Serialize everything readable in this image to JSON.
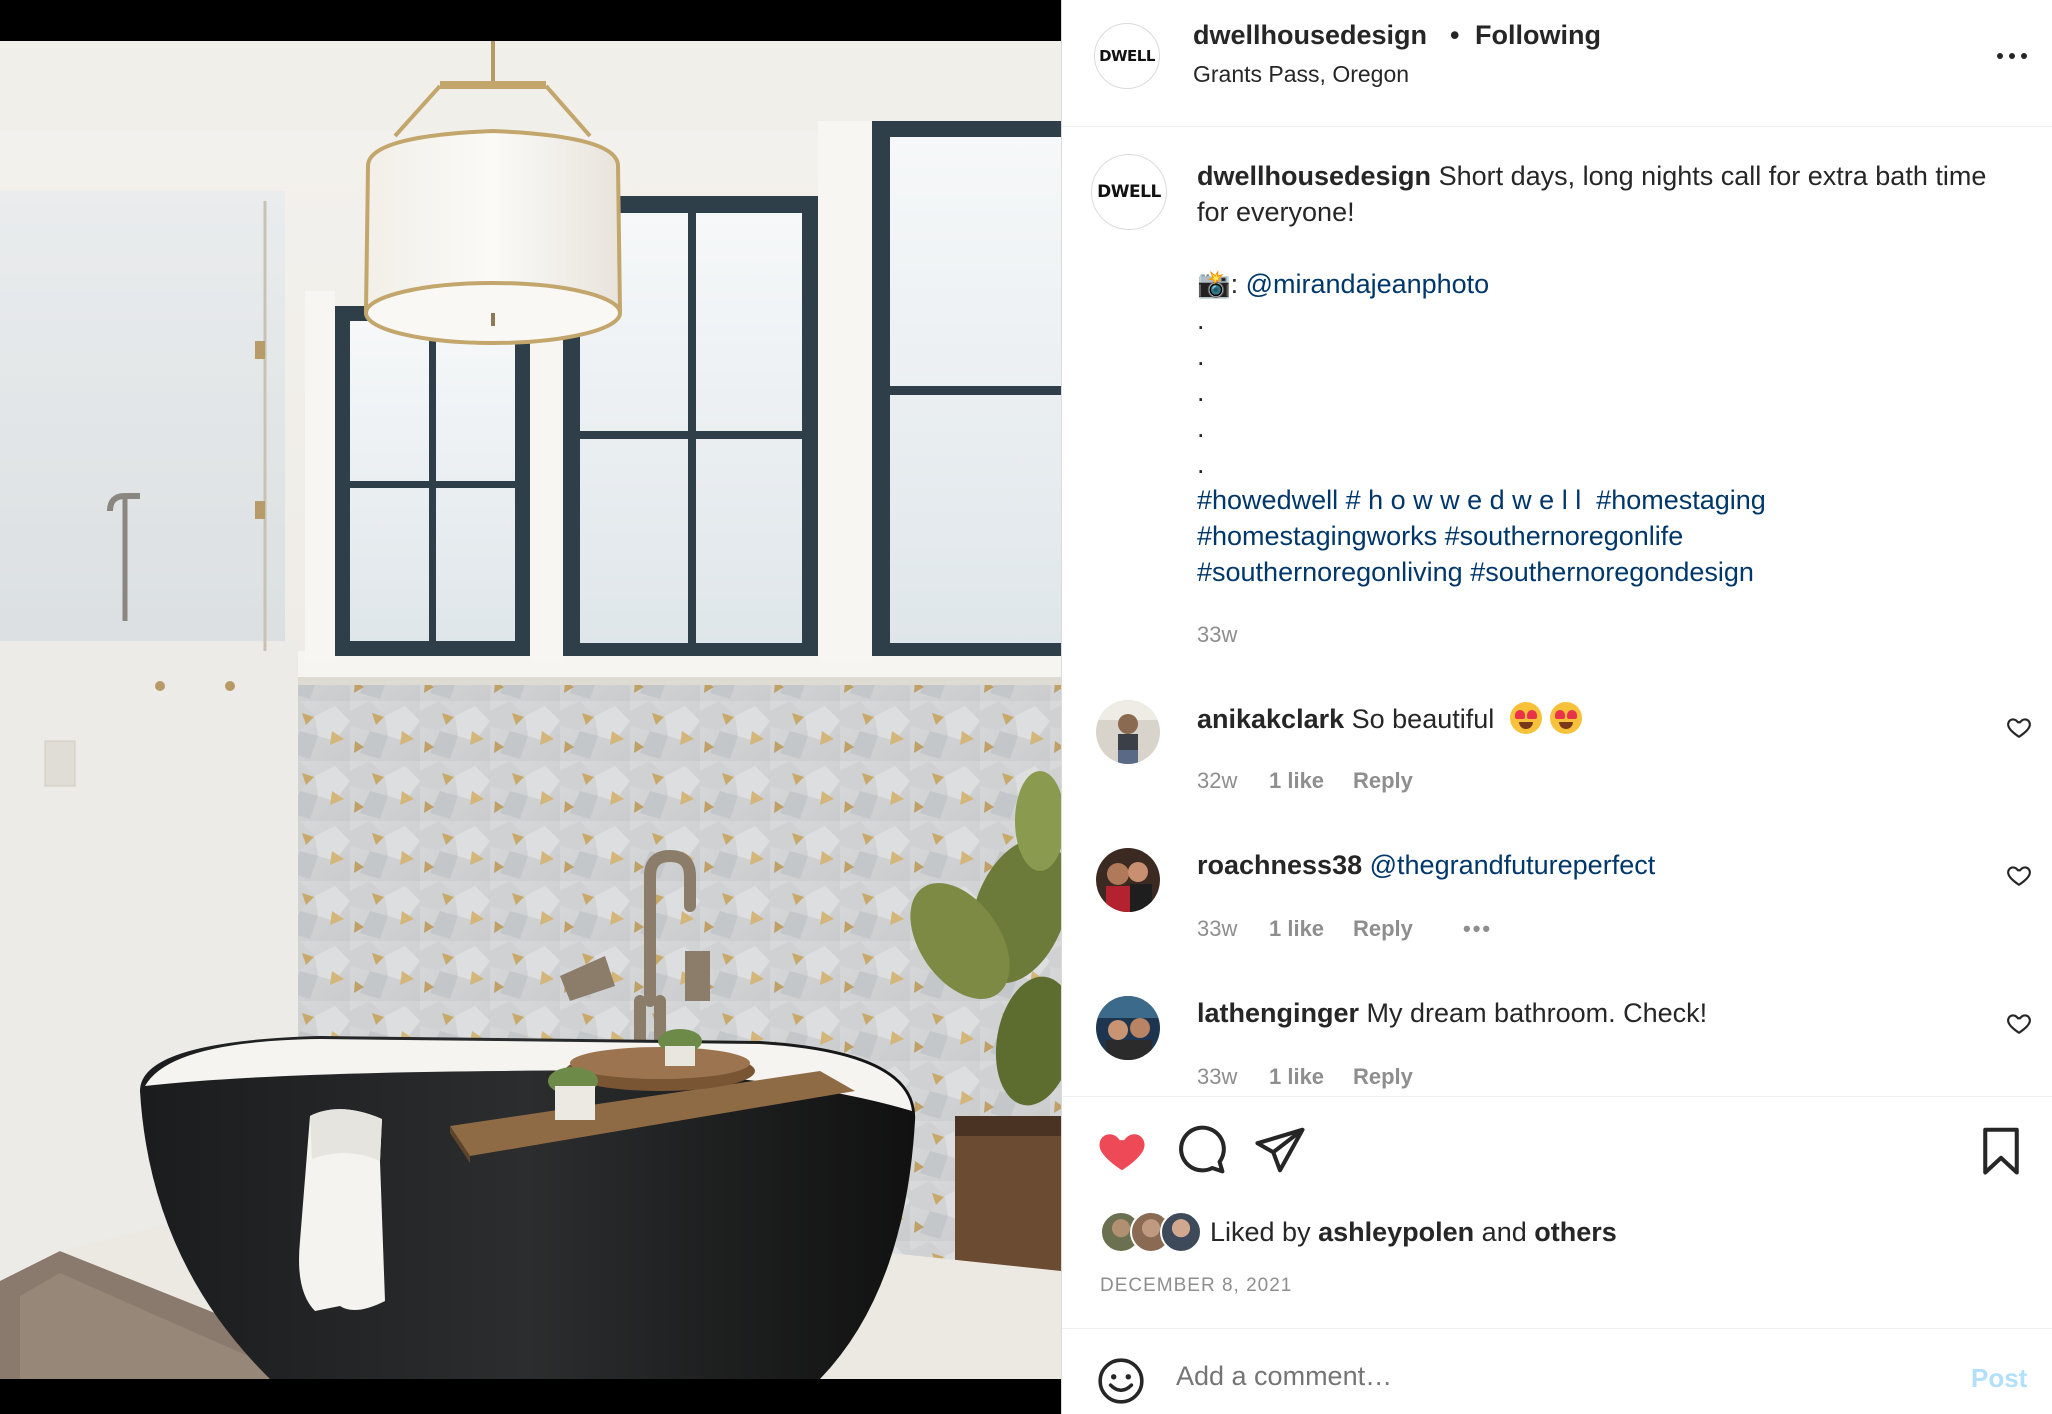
{
  "header": {
    "username": "dwellhousedesign",
    "separator": "•",
    "follow_status": "Following",
    "location": "Grants Pass, Oregon",
    "avatar_logo_text": "DWELL",
    "more_icon": "more-horizontal-icon"
  },
  "caption": {
    "username": "dwellhousedesign",
    "text": "Short days, long nights call for extra bath time for everyone!",
    "photo_credit_prefix": "📸: ",
    "photo_credit_mention": "@mirandajeanphoto",
    "dots": [
      ".",
      ".",
      ".",
      ".",
      "."
    ],
    "hashtags_line1": "#howedwell # h o w w e d w e l l  #homestaging",
    "hashtags_line2": "#homestagingworks #southernoregonlife",
    "hashtags_line3": "#southernoregonliving #southernoregondesign",
    "time": "33w"
  },
  "comments": [
    {
      "username": "anikakclark",
      "text": "So beautiful",
      "emojis": [
        "heart-eyes-emoji",
        "heart-eyes-emoji"
      ],
      "time": "32w",
      "likes": "1 like",
      "reply": "Reply"
    },
    {
      "username": "roachness38",
      "mention": "@thegrandfutureperfect",
      "time": "33w",
      "likes": "1 like",
      "reply": "Reply",
      "more": "•••"
    },
    {
      "username": "lathenginger",
      "text": "My dream bathroom. Check!",
      "time": "33w",
      "likes": "1 like",
      "reply": "Reply"
    }
  ],
  "actions": {
    "like_icon": "heart-filled-icon",
    "comment_icon": "comment-icon",
    "share_icon": "send-icon",
    "save_icon": "bookmark-icon",
    "like_color": "#ed4956",
    "liked_by_prefix": "Liked by",
    "liked_by_user": "ashleypolen",
    "liked_by_and": "and",
    "liked_by_others": "others",
    "date": "DECEMBER 8, 2021"
  },
  "add_comment": {
    "placeholder": "Add a comment…",
    "post_label": "Post",
    "emoji_icon": "smile-icon",
    "post_color": "#b2dffc"
  },
  "colors": {
    "link": "#00376b",
    "muted": "#8e8e8e",
    "text": "#262626"
  }
}
